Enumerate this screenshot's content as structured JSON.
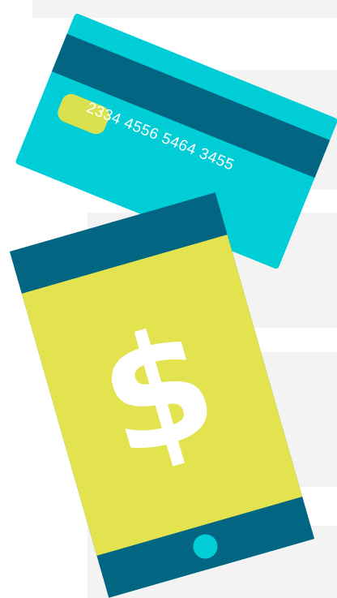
{
  "card": {
    "number": "2334 4556 5464 3455"
  },
  "phone": {
    "symbol": "$"
  },
  "colors": {
    "background_band": "#f3f3f3",
    "card_body": "#00cdd6",
    "dark_teal": "#026581",
    "chip": "#d9e24e",
    "screen": "#e3e24f",
    "symbol": "#ffffff",
    "home_button": "#00cdd6"
  }
}
